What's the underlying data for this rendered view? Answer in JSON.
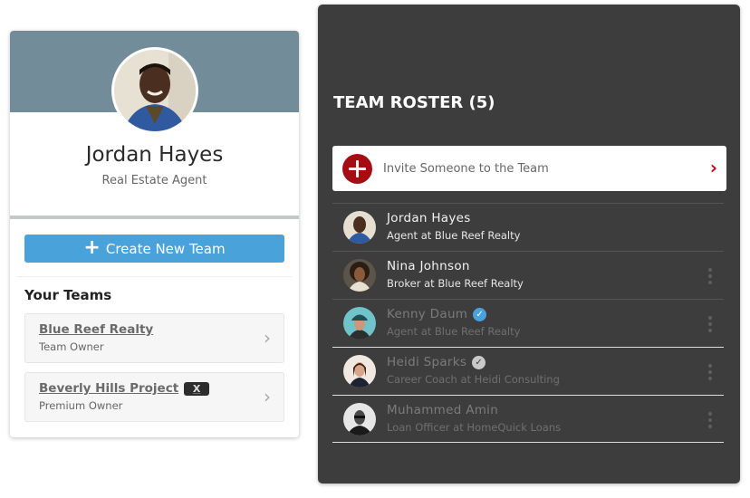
{
  "profile": {
    "name": "Jordan Hayes",
    "title": "Real Estate Agent",
    "banner_color": "#738c99"
  },
  "actions": {
    "create_team_label": "Create New Team",
    "create_team_icon": "plus-icon"
  },
  "teams": {
    "heading": "Your Teams",
    "items": [
      {
        "name": "Blue Reef Realty",
        "role": "Team Owner",
        "badge": null
      },
      {
        "name": "Beverly Hills Project",
        "role": "Premium Owner",
        "badge": "X"
      }
    ]
  },
  "roster": {
    "title": "TEAM ROSTER (5)",
    "invite_label": "Invite Someone to the Team",
    "accent_color": "#a50d12",
    "members": [
      {
        "name": "Jordan Hayes",
        "subtitle": "Agent at Blue Reef Realty",
        "verified": null,
        "dim": false,
        "menu": false
      },
      {
        "name": "Nina Johnson",
        "subtitle": "Broker at Blue Reef Realty",
        "verified": null,
        "dim": false,
        "menu": true
      },
      {
        "name": "Kenny Daum",
        "subtitle": "Agent at Blue Reef Realty",
        "verified": "blue",
        "dim": true,
        "menu": true
      },
      {
        "name": "Heidi Sparks",
        "subtitle": "Career Coach at Heidi Consulting",
        "verified": "gray",
        "dim": true,
        "menu": true
      },
      {
        "name": "Muhammed Amin",
        "subtitle": "Loan Officer at HomeQuick Loans",
        "verified": null,
        "dim": true,
        "menu": true
      }
    ]
  },
  "icons": {
    "chevron": "›",
    "check": "✓"
  }
}
